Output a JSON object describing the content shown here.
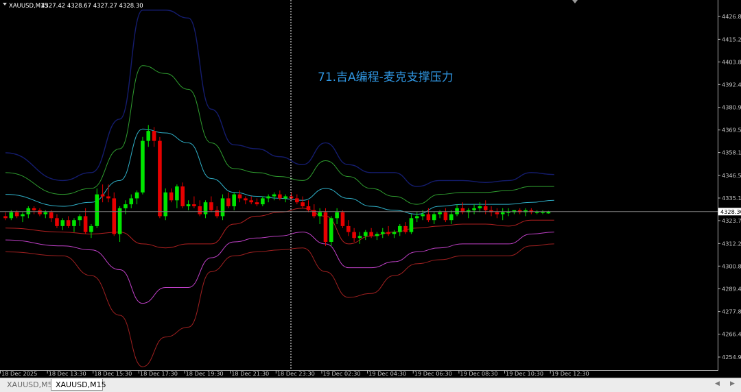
{
  "header": {
    "symbol_info": "XAUUSD,M15",
    "ohlc": "4327.42 4328.67 4327.27 4328.30"
  },
  "annotation": "71.吉A编程-麦克支撑压力",
  "current_price_label": "4328.30",
  "tabs": [
    {
      "label": "XAUUSD,M5",
      "active": false
    },
    {
      "label": "XAUUSD,M15",
      "active": true
    }
  ],
  "colors": {
    "background": "#000000",
    "bull": "#00e600",
    "bear": "#e60000",
    "band_outer_upper": "#141c6e",
    "band_mid_upper": "#2f9e2f",
    "band_inner_upper": "#2fb0c8",
    "band_inner_lower": "#b32020",
    "band_mid_lower": "#c040c8",
    "band_outer_lower": "#a02020",
    "axis_text": "#c8c8c8",
    "annotation": "#2f95e0",
    "price_line": "#808080"
  },
  "chart_data": {
    "type": "candlestick",
    "symbol": "XAUUSD",
    "timeframe": "M15",
    "y_ticks": [
      4426.8,
      4415.25,
      4403.85,
      4392.45,
      4380.9,
      4369.5,
      4358.1,
      4346.55,
      4335.15,
      4323.75,
      4312.2,
      4300.8,
      4289.4,
      4277.85,
      4266.45,
      4254.9
    ],
    "ylim": [
      4250.6,
      4432.1
    ],
    "x_tick_labels": [
      "18 Dec 2025",
      "18 Dec 13:30",
      "18 Dec 15:30",
      "18 Dec 17:30",
      "18 Dec 19:30",
      "18 Dec 21:30",
      "18 Dec 23:30",
      "19 Dec 02:30",
      "19 Dec 04:30",
      "19 Dec 06:30",
      "19 Dec 08:30",
      "19 Dec 10:30",
      "19 Dec 12:30"
    ],
    "x_tick_bar_index": [
      0,
      8,
      16,
      24,
      32,
      40,
      48,
      56,
      64,
      72,
      80,
      88,
      96
    ],
    "crosshair_bar": 50,
    "current_price": 4328.3,
    "candles": [
      [
        4326,
        4328,
        4324,
        4325
      ],
      [
        4325,
        4329,
        4324,
        4328
      ],
      [
        4328,
        4329,
        4325,
        4326
      ],
      [
        4326,
        4328,
        4323,
        4327
      ],
      [
        4327,
        4331,
        4325,
        4330
      ],
      [
        4330,
        4331,
        4327,
        4329
      ],
      [
        4329,
        4330,
        4326,
        4327
      ],
      [
        4327,
        4329,
        4325,
        4328
      ],
      [
        4328,
        4329,
        4323,
        4325
      ],
      [
        4325,
        4327,
        4320,
        4321
      ],
      [
        4321,
        4325,
        4319,
        4324
      ],
      [
        4324,
        4326,
        4320,
        4321
      ],
      [
        4321,
        4325,
        4318,
        4324
      ],
      [
        4324,
        4327,
        4321,
        4326
      ],
      [
        4326,
        4330,
        4317,
        4318
      ],
      [
        4318,
        4322,
        4315,
        4321
      ],
      [
        4321,
        4340,
        4320,
        4337
      ],
      [
        4337,
        4342,
        4333,
        4336
      ],
      [
        4336,
        4342,
        4333,
        4335
      ],
      [
        4335,
        4338,
        4316,
        4317
      ],
      [
        4317,
        4331,
        4313,
        4330
      ],
      [
        4330,
        4334,
        4327,
        4332
      ],
      [
        4332,
        4337,
        4330,
        4335
      ],
      [
        4335,
        4339,
        4332,
        4338
      ],
      [
        4338,
        4366,
        4337,
        4364
      ],
      [
        4364,
        4372,
        4361,
        4369
      ],
      [
        4369,
        4371,
        4361,
        4364
      ],
      [
        4364,
        4366,
        4325,
        4326
      ],
      [
        4326,
        4340,
        4324,
        4338
      ],
      [
        4338,
        4340,
        4333,
        4334
      ],
      [
        4334,
        4342,
        4330,
        4341
      ],
      [
        4341,
        4343,
        4330,
        4331
      ],
      [
        4331,
        4334,
        4329,
        4332
      ],
      [
        4332,
        4336,
        4330,
        4331
      ],
      [
        4331,
        4334,
        4326,
        4327
      ],
      [
        4327,
        4334,
        4325,
        4333
      ],
      [
        4333,
        4336,
        4328,
        4329
      ],
      [
        4329,
        4331,
        4325,
        4326
      ],
      [
        4326,
        4337,
        4324,
        4335
      ],
      [
        4335,
        4338,
        4330,
        4331
      ],
      [
        4331,
        4338,
        4329,
        4337
      ],
      [
        4337,
        4339,
        4333,
        4335
      ],
      [
        4335,
        4336,
        4332,
        4334
      ],
      [
        4334,
        4336,
        4332,
        4333
      ],
      [
        4333,
        4335,
        4331,
        4332
      ],
      [
        4332,
        4336,
        4331,
        4335
      ],
      [
        4335,
        4337,
        4333,
        4336
      ],
      [
        4336,
        4338,
        4334,
        4337
      ],
      [
        4337,
        4339,
        4334,
        4335
      ],
      [
        4335,
        4337,
        4333,
        4336
      ],
      [
        4336,
        4338,
        4334,
        4335
      ],
      [
        4335,
        4337,
        4332,
        4333
      ],
      [
        4333,
        4336,
        4330,
        4331
      ],
      [
        4331,
        4334,
        4328,
        4329
      ],
      [
        4329,
        4332,
        4325,
        4326
      ],
      [
        4326,
        4330,
        4322,
        4328
      ],
      [
        4328,
        4330,
        4311,
        4313
      ],
      [
        4313,
        4326,
        4311,
        4325
      ],
      [
        4325,
        4330,
        4322,
        4328
      ],
      [
        4328,
        4329,
        4320,
        4321
      ],
      [
        4321,
        4324,
        4316,
        4318
      ],
      [
        4318,
        4320,
        4313,
        4315
      ],
      [
        4315,
        4318,
        4312,
        4316
      ],
      [
        4316,
        4319,
        4314,
        4318
      ],
      [
        4318,
        4320,
        4315,
        4316
      ],
      [
        4316,
        4318,
        4314,
        4317
      ],
      [
        4317,
        4320,
        4315,
        4318
      ],
      [
        4318,
        4321,
        4316,
        4317
      ],
      [
        4317,
        4319,
        4315,
        4318
      ],
      [
        4318,
        4322,
        4316,
        4321
      ],
      [
        4321,
        4323,
        4317,
        4318
      ],
      [
        4318,
        4327,
        4317,
        4325
      ],
      [
        4325,
        4328,
        4323,
        4326
      ],
      [
        4326,
        4329,
        4324,
        4327
      ],
      [
        4327,
        4330,
        4323,
        4324
      ],
      [
        4324,
        4328,
        4322,
        4327
      ],
      [
        4327,
        4329,
        4325,
        4328
      ],
      [
        4328,
        4330,
        4323,
        4324
      ],
      [
        4324,
        4329,
        4322,
        4327
      ],
      [
        4327,
        4332,
        4326,
        4330
      ],
      [
        4330,
        4333,
        4327,
        4328
      ],
      [
        4328,
        4330,
        4325,
        4329
      ],
      [
        4329,
        4332,
        4327,
        4330
      ],
      [
        4330,
        4333,
        4328,
        4331
      ],
      [
        4331,
        4334,
        4327,
        4329
      ],
      [
        4329,
        4331,
        4326,
        4328
      ],
      [
        4328,
        4330,
        4325,
        4327
      ],
      [
        4327,
        4330,
        4324,
        4328
      ],
      [
        4328,
        4330,
        4326,
        4328
      ],
      [
        4328,
        4329,
        4327,
        4329
      ],
      [
        4329,
        4330,
        4327,
        4328
      ],
      [
        4328,
        4330,
        4326,
        4329
      ],
      [
        4329,
        4330,
        4327,
        4328
      ],
      [
        4328,
        4329,
        4327,
        4328
      ],
      [
        4328,
        4329,
        4327,
        4328
      ],
      [
        4327.42,
        4328.67,
        4327.27,
        4328.3
      ]
    ],
    "band_x_bars": [
      0,
      10,
      15,
      20,
      24,
      28,
      32,
      36,
      40,
      44,
      48,
      52,
      56,
      60,
      64,
      68,
      72,
      76,
      80,
      84,
      88,
      92,
      96
    ],
    "bands": [
      {
        "name": "outer_upper",
        "values": [
          4358,
          4344,
          4348,
          4375,
          4430,
          4430,
          4426,
          4380,
          4362,
          4360,
          4356,
          4352,
          4363,
          4352,
          4348,
          4348,
          4341,
          4344,
          4344,
          4343,
          4344,
          4348,
          4347
        ]
      },
      {
        "name": "mid_upper",
        "values": [
          4348,
          4337,
          4340,
          4360,
          4402,
          4398,
          4390,
          4363,
          4350,
          4348,
          4346,
          4344,
          4354,
          4346,
          4340,
          4336,
          4332,
          4337,
          4338,
          4338,
          4339,
          4341,
          4341
        ]
      },
      {
        "name": "inner_upper",
        "values": [
          4337,
          4331,
          4333,
          4344,
          4370,
          4368,
          4363,
          4345,
          4338,
          4336,
          4335,
          4334,
          4340,
          4335,
          4331,
          4329,
          4327,
          4331,
          4332,
          4332,
          4332,
          4333,
          4334
        ]
      },
      {
        "name": "inner_lower",
        "values": [
          4320,
          4318,
          4317,
          4318,
          4312,
          4310,
          4312,
          4312,
          4322,
          4326,
          4328,
          4330,
          4326,
          4312,
          4316,
          4318,
          4320,
          4321,
          4322,
          4322,
          4321,
          4324,
          4324
        ]
      },
      {
        "name": "mid_lower",
        "values": [
          4314,
          4311,
          4309,
          4299,
          4282,
          4290,
          4290,
          4305,
          4313,
          4315,
          4316,
          4318,
          4312,
          4300,
          4300,
          4303,
          4308,
          4310,
          4312,
          4312,
          4312,
          4317,
          4318
        ]
      },
      {
        "name": "outer_lower",
        "values": [
          4308,
          4306,
          4296,
          4276,
          4250,
          4265,
          4270,
          4298,
          4306,
          4308,
          4309,
          4310,
          4298,
          4285,
          4287,
          4296,
          4302,
          4304,
          4306,
          4306,
          4306,
          4311,
          4312
        ]
      }
    ]
  }
}
